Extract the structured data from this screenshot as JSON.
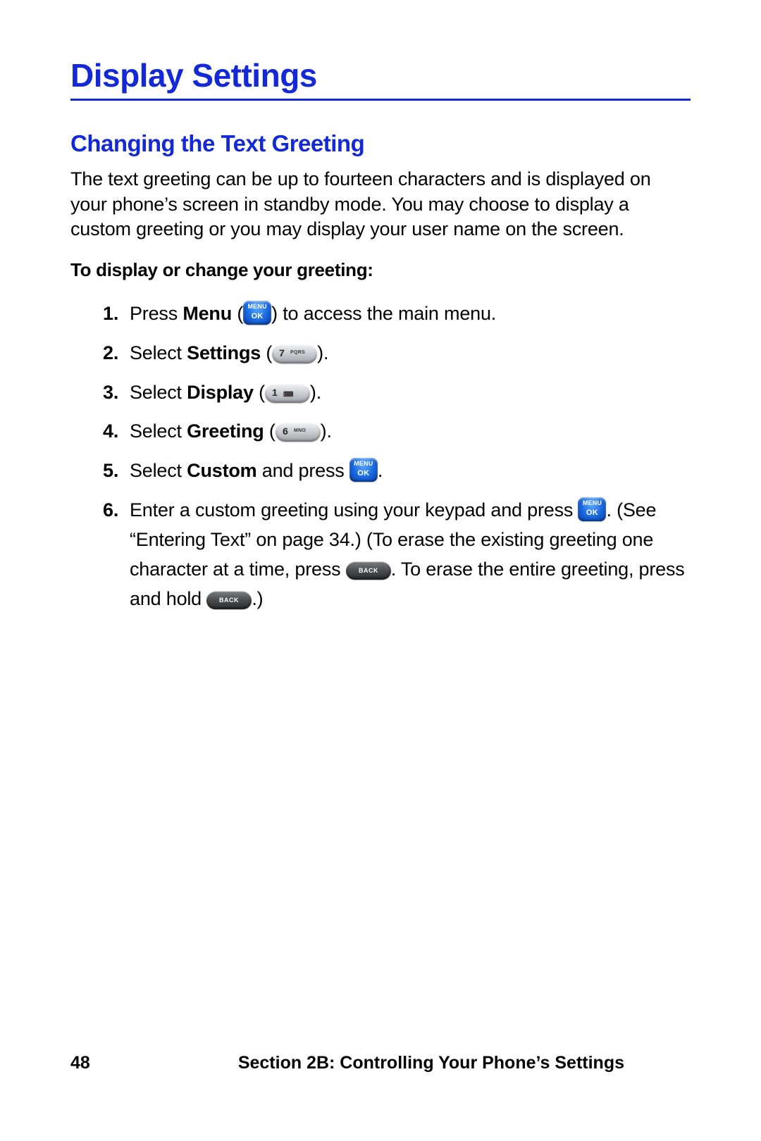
{
  "title": "Display Settings",
  "section": {
    "heading": "Changing the Text Greeting",
    "intro": "The text greeting can be up to fourteen characters and is displayed on your phone’s screen in standby mode. You may choose to display a custom greeting or you may display your user name on the screen.",
    "subhead": "To display or change your greeting:"
  },
  "steps": {
    "s1": {
      "num": "1.",
      "a": "Press ",
      "b": "Menu",
      "c": " (",
      "d": ") to access the main menu."
    },
    "s2": {
      "num": "2.",
      "a": "Select ",
      "b": "Settings",
      "c": " (",
      "d": ")."
    },
    "s3": {
      "num": "3.",
      "a": "Select ",
      "b": "Display",
      "c": " (",
      "d": ")."
    },
    "s4": {
      "num": "4.",
      "a": "Select ",
      "b": "Greeting",
      "c": " (",
      "d": ")."
    },
    "s5": {
      "num": "5.",
      "a": "Select ",
      "b": "Custom",
      "c": " and press ",
      "d": "."
    },
    "s6": {
      "num": "6.",
      "a": "Enter a custom greeting using your keypad and press ",
      "b": ". (See “Entering Text” on page 34.) (To erase the existing greeting one character at a time, press ",
      "c": ". To erase the entire greeting, press and hold ",
      "d": ".)"
    }
  },
  "keys": {
    "menu_top": "MENU",
    "menu_bottom": "OK",
    "k7_big": "7",
    "k7_small": "PQRS",
    "k1_big": "1",
    "k1_small": "⌨",
    "k6_big": "6",
    "k6_small": "MNO",
    "back": "BACK"
  },
  "footer": {
    "page": "48",
    "label": "Section 2B: Controlling Your Phone’s Settings"
  }
}
